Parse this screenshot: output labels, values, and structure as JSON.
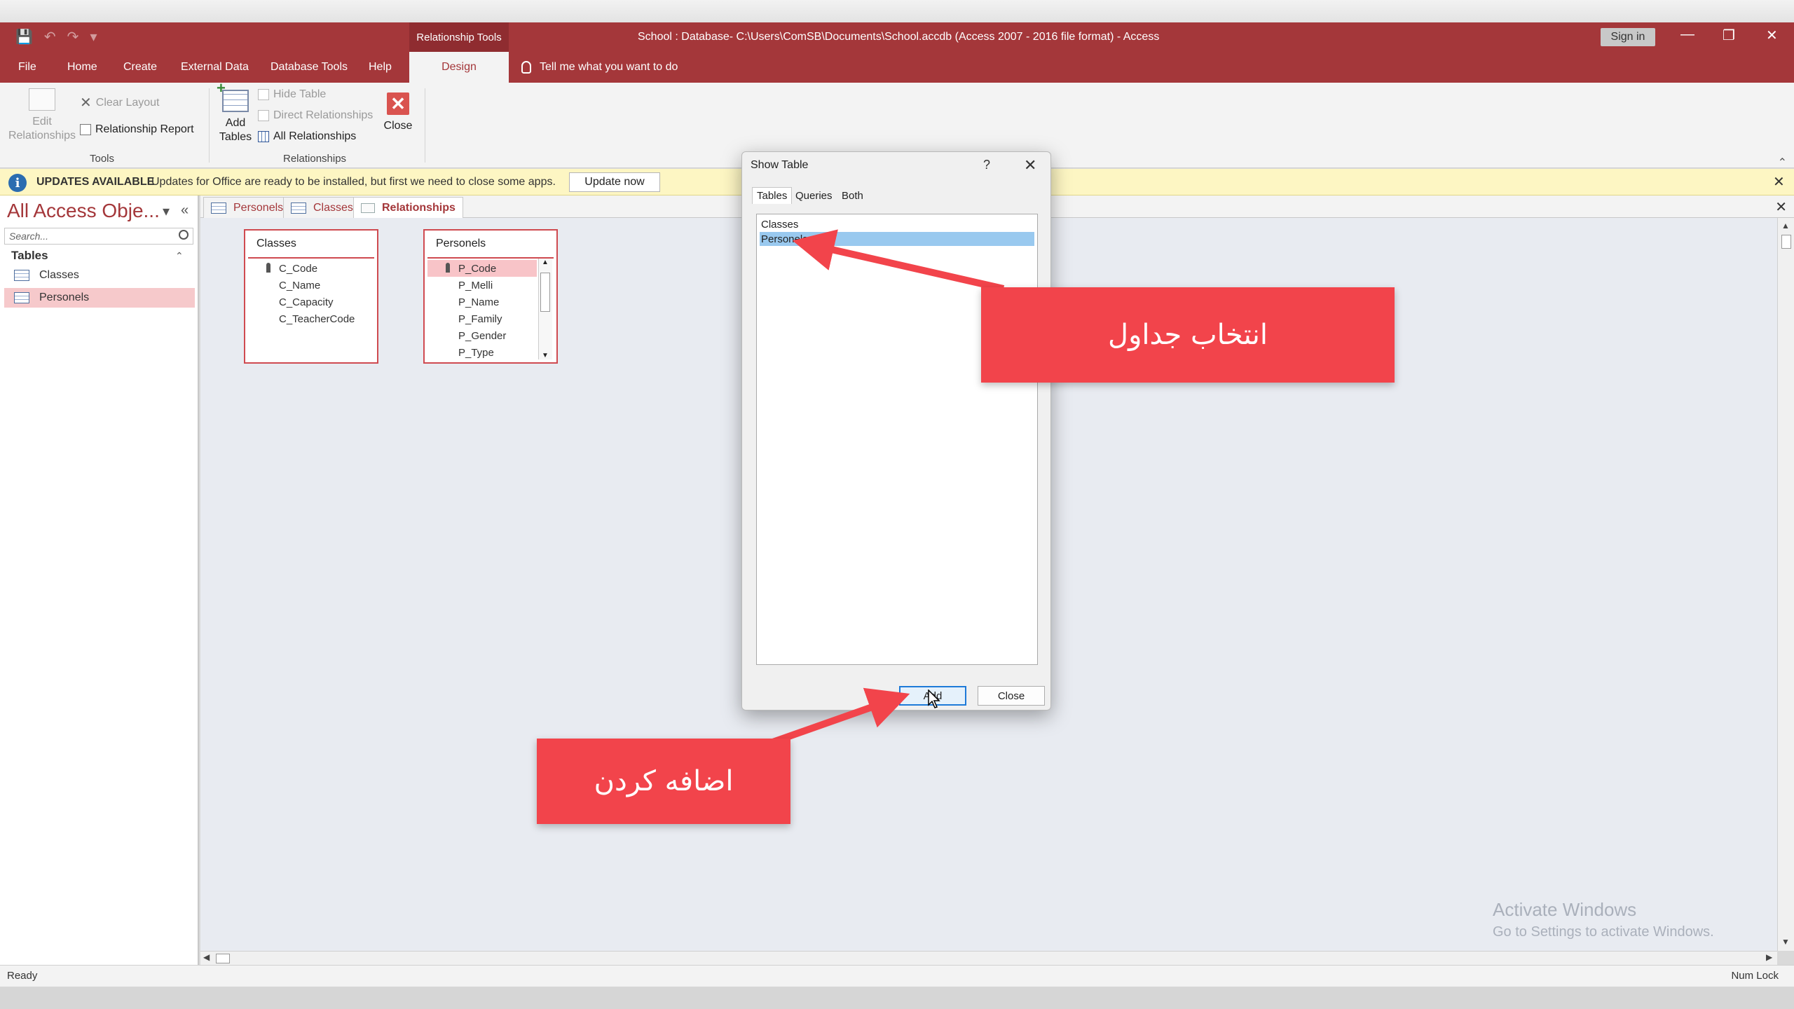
{
  "titlebar": {
    "context_title": "Relationship Tools",
    "window_title": "School : Database- C:\\Users\\ComSB\\Documents\\School.accdb (Access 2007 - 2016 file format)  -  Access",
    "signin_label": "Sign in"
  },
  "ribbon_tabs": {
    "file": "File",
    "home": "Home",
    "create": "Create",
    "external_data": "External Data",
    "database_tools": "Database Tools",
    "help": "Help",
    "design": "Design",
    "tell_me": "Tell me what you want to do"
  },
  "ribbon": {
    "tools": {
      "edit_relationships": [
        "Edit",
        "Relationships"
      ],
      "clear_layout": "Clear Layout",
      "relationship_report": "Relationship Report",
      "group_label": "Tools"
    },
    "relationships": {
      "add_tables": [
        "Add",
        "Tables"
      ],
      "hide_table": "Hide Table",
      "direct_relationships": "Direct Relationships",
      "all_relationships": "All Relationships",
      "close": "Close",
      "group_label": "Relationships"
    }
  },
  "message_bar": {
    "title": "UPDATES AVAILABLE",
    "text": "Updates for Office are ready to be installed, but first we need to close some apps.",
    "button": "Update now"
  },
  "nav_pane": {
    "title": "All Access Obje...",
    "search_placeholder": "Search...",
    "section": "Tables",
    "items": [
      "Classes",
      "Personels"
    ]
  },
  "doc_tabs": [
    "Personels",
    "Classes",
    "Relationships"
  ],
  "field_lists": [
    {
      "title": "Classes",
      "fields": [
        "C_Code",
        "C_Name",
        "C_Capacity",
        "C_TeacherCode"
      ]
    },
    {
      "title": "Personels",
      "fields": [
        "P_Code",
        "P_Melli",
        "P_Name",
        "P_Family",
        "P_Gender",
        "P_Type"
      ]
    }
  ],
  "dialog": {
    "title": "Show Table",
    "help": "?",
    "tabs": [
      "Tables",
      "Queries",
      "Both"
    ],
    "items": [
      "Classes",
      "Personels"
    ],
    "add_button": "Add",
    "close_button": "Close"
  },
  "annotations": {
    "select_tables": "انتخاب جداول",
    "add": "اضافه کردن"
  },
  "watermark": {
    "line1": "Activate Windows",
    "line2": "Go to Settings to activate Windows."
  },
  "status": {
    "left": "Ready",
    "right": "Num Lock"
  },
  "colors": {
    "access_red": "#a4373a",
    "callout_red": "#f2444b",
    "selection_blue": "#99c9ef",
    "message_bar": "#fdf6c3"
  }
}
